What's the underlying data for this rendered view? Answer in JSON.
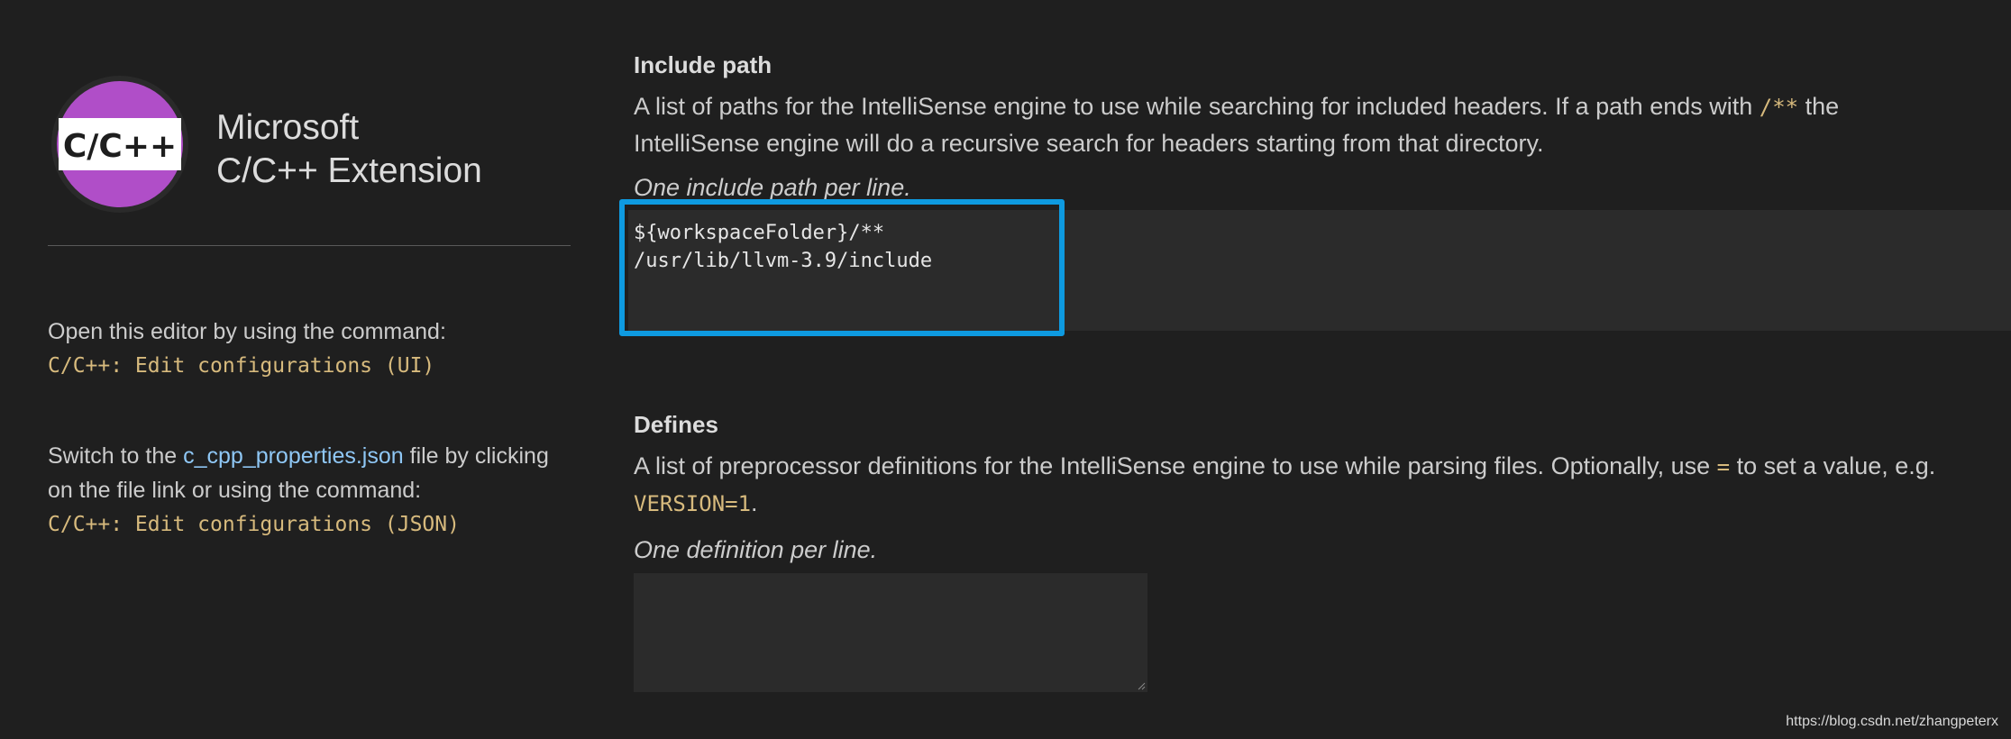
{
  "sidebar": {
    "logo_text": "C/C++",
    "title_line1": "Microsoft",
    "title_line2": "C/C++ Extension",
    "open_editor_text": "Open this editor by using the command:",
    "open_editor_command": "C/C++: Edit configurations (UI)",
    "switch_prefix": "Switch to the ",
    "switch_link": "c_cpp_properties.json",
    "switch_suffix": " file by clicking on the file link or using the command:",
    "switch_command": "C/C++: Edit configurations (JSON)"
  },
  "include_path": {
    "title": "Include path",
    "desc_part1": "A list of paths for the IntelliSense engine to use while searching for included headers. If a path ends with ",
    "desc_code": "/**",
    "desc_part2": " the IntelliSense engine will do a recursive search for headers starting from that directory.",
    "hint": "One include path per line.",
    "value": "${workspaceFolder}/**\n/usr/lib/llvm-3.9/include"
  },
  "defines": {
    "title": "Defines",
    "desc_part1": "A list of preprocessor definitions for the IntelliSense engine to use while parsing files. Optionally, use ",
    "desc_code1": "=",
    "desc_part2": " to set a value, e.g. ",
    "desc_code2": "VERSION=1",
    "desc_part3": ".",
    "hint": "One definition per line.",
    "value": ""
  },
  "watermark": "https://blog.csdn.net/zhangpeterx",
  "colors": {
    "background": "#1f1f1f",
    "textarea_bg": "#2b2b2b",
    "focus_border": "#0e9ae0",
    "code_color": "#d7ba7d",
    "link_color": "#8fc7f5",
    "logo_purple": "#b04ec8"
  }
}
